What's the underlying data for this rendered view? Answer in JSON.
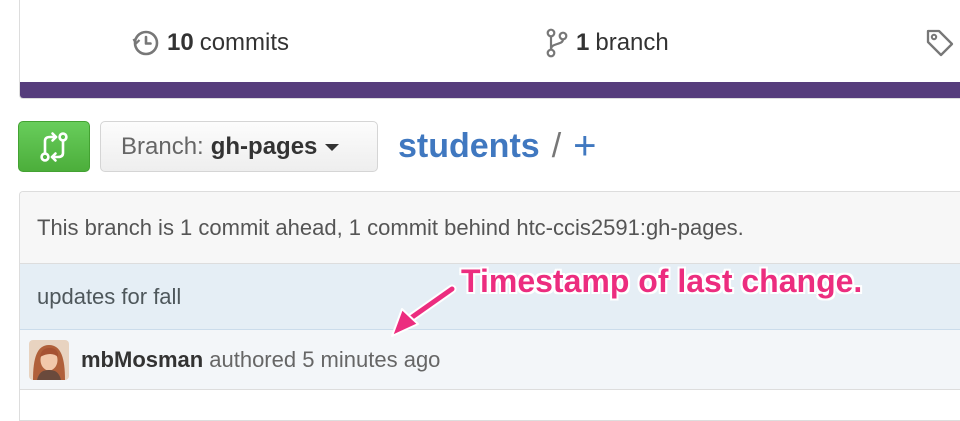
{
  "summary": {
    "commits_count": "10",
    "commits_label": "commits",
    "branches_count": "1",
    "branches_label": "branch",
    "language_bar_colors": [
      "#563d7c",
      "#e34c26"
    ]
  },
  "navigation": {
    "branch_prefix": "Branch:",
    "branch_name": "gh-pages",
    "repo_name": "students",
    "path_separator": "/",
    "add_file_glyph": "+"
  },
  "commit_box": {
    "branch_status": "This branch is 1 commit ahead, 1 commit behind htc-ccis2591:gh-pages.",
    "commit_message": "updates for fall",
    "author": "mbMosman",
    "authored_text": "authored 5 minutes ago"
  },
  "annotation": {
    "text": "Timestamp of last change.",
    "color": "#ec2d7f"
  },
  "icons": {
    "commits": "history-icon",
    "branch": "git-branch-icon",
    "tags": "tag-icon",
    "compare": "git-compare-icon",
    "dropdown": "caret-down-icon"
  }
}
